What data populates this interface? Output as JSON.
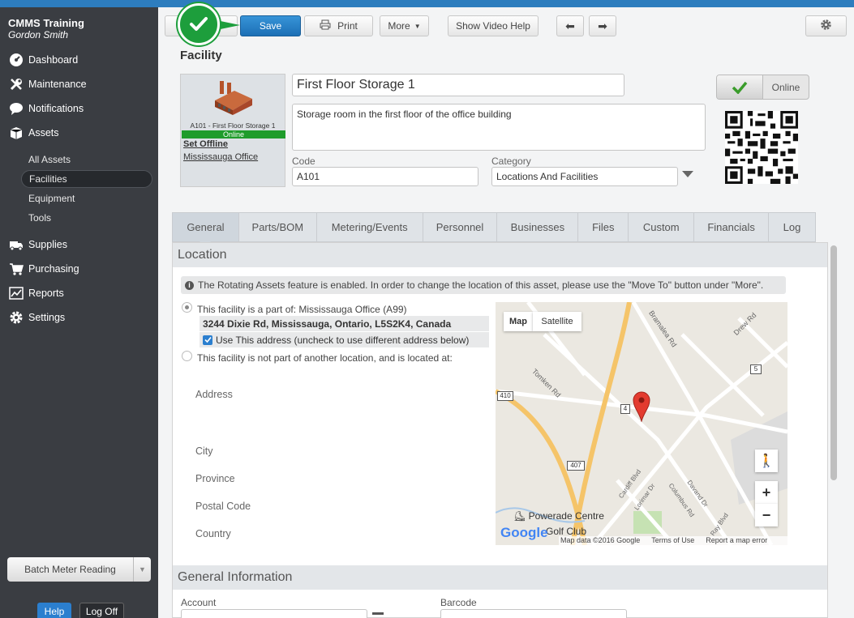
{
  "sidebar": {
    "org": "CMMS Training",
    "user": "Gordon Smith",
    "nav": [
      {
        "label": "Dashboard",
        "icon": "dashboard-icon"
      },
      {
        "label": "Maintenance",
        "icon": "wrench-icon"
      },
      {
        "label": "Notifications",
        "icon": "speech-bubble-icon"
      },
      {
        "label": "Assets",
        "icon": "box-icon"
      }
    ],
    "assets_sub": [
      "All Assets",
      "Facilities",
      "Equipment",
      "Tools"
    ],
    "nav2": [
      {
        "label": "Supplies",
        "icon": "truck-icon"
      },
      {
        "label": "Purchasing",
        "icon": "cart-icon"
      },
      {
        "label": "Reports",
        "icon": "chart-icon"
      },
      {
        "label": "Settings",
        "icon": "gear-icon"
      }
    ],
    "batch_label": "Batch Meter Reading",
    "help_label": "Help",
    "logoff_label": "Log Off"
  },
  "toolbar": {
    "save": "Save",
    "print": "Print",
    "more": "More",
    "video": "Show Video Help"
  },
  "facility": {
    "heading": "Facility",
    "image_label": "A101 - First Floor Storage 1",
    "status": "Online",
    "set_offline": "Set Offline",
    "parent_link": "Mississauga Office",
    "name": "First Floor Storage 1",
    "description": "Storage room in the first floor of the office building",
    "code_label": "Code",
    "code": "A101",
    "category_label": "Category",
    "category": "Locations And Facilities",
    "online_toggle": "Online"
  },
  "tabs": [
    "General",
    "Parts/BOM",
    "Metering/Events",
    "Personnel",
    "Businesses",
    "Files",
    "Custom",
    "Financials",
    "Log"
  ],
  "location": {
    "title": "Location",
    "info": "The Rotating Assets feature is enabled. In order to change the location of this asset, please use the \"Move To\" button under \"More\".",
    "option1": "This facility is a part of: Mississauga Office (A99)",
    "address": "3244 Dixie Rd, Mississauga, Ontario, L5S2K4, Canada",
    "use_address": "Use This address (uncheck to use different address below)",
    "option2": "This facility is not part of another location, and is located at:",
    "fields": [
      "Address",
      "City",
      "Province",
      "Postal Code",
      "Country"
    ]
  },
  "map": {
    "tab_map": "Map",
    "tab_satellite": "Satellite",
    "roads": [
      "Bramalea Rd",
      "Drew Rd",
      "Tomken Rd",
      "Cardiff Blvd",
      "Lorimar Dr",
      "Columbus Rd",
      "Davand Dr",
      "Ray Blvd"
    ],
    "shields": [
      "5",
      "410",
      "4",
      "407"
    ],
    "place": "Powerade Centre",
    "golf": "Golf Club",
    "google": "Google",
    "footer": [
      "Map data ©2016 Google",
      "Terms of Use",
      "Report a map error"
    ],
    "zoom_in": "+",
    "zoom_out": "−"
  },
  "general": {
    "title": "General Information",
    "account_label": "Account",
    "barcode_label": "Barcode"
  }
}
